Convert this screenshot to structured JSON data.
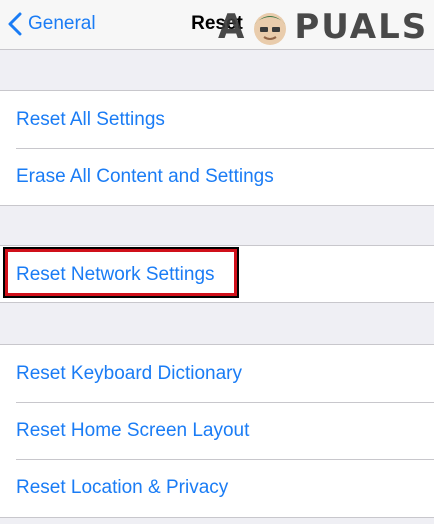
{
  "navbar": {
    "back_label": "General",
    "title": "Reset",
    "watermark": {
      "pre": "A",
      "post": "PUALS"
    }
  },
  "groups": [
    {
      "items": [
        {
          "label": "Reset All Settings"
        },
        {
          "label": "Erase All Content and Settings"
        }
      ]
    },
    {
      "items": [
        {
          "label": "Reset Network Settings"
        }
      ]
    },
    {
      "items": [
        {
          "label": "Reset Keyboard Dictionary"
        },
        {
          "label": "Reset Home Screen Layout"
        },
        {
          "label": "Reset Location & Privacy"
        }
      ]
    }
  ],
  "highlight": {
    "target": "Reset Network Settings",
    "color": "#d0101a"
  },
  "colors": {
    "accent": "#1a7cf5",
    "background": "#efeff4",
    "separator": "#c8c7cc"
  }
}
